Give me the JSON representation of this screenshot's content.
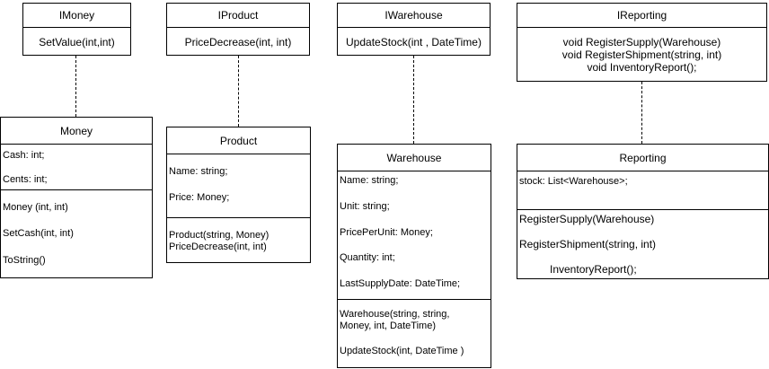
{
  "imoney": {
    "name": "IMoney",
    "methods": [
      "SetValue(int,int)"
    ]
  },
  "iproduct": {
    "name": "IProduct",
    "methods": [
      "PriceDecrease(int, int)"
    ]
  },
  "iwarehouse": {
    "name": "IWarehouse",
    "methods": [
      "UpdateStock(int , DateTime)"
    ]
  },
  "ireporting": {
    "name": "IReporting",
    "methods": [
      "void RegisterSupply(Warehouse)",
      "void RegisterShipment(string, int)",
      "void InventoryReport();"
    ]
  },
  "money": {
    "name": "Money",
    "fields": [
      "Cash: int;",
      "Cents: int;"
    ],
    "methods": [
      "Money (int, int)",
      "SetCash(int, int)",
      "ToString()"
    ]
  },
  "product": {
    "name": "Product",
    "fields": [
      "Name: string;",
      "Price: Money;"
    ],
    "methods": [
      "Product(string, Money)",
      "PriceDecrease(int, int)"
    ]
  },
  "warehouse": {
    "name": "Warehouse",
    "fields": [
      "Name: string;",
      "Unit: string;",
      "PricePerUnit: Money;",
      "Quantity: int;",
      "LastSupplyDate: DateTime;"
    ],
    "methods": [
      "Warehouse(string, string,",
      "Money, int, DateTime)",
      "UpdateStock(int, DateTime )"
    ]
  },
  "reporting": {
    "name": "Reporting",
    "fields": [
      "stock: List<Warehouse>;"
    ],
    "methods": [
      "RegisterSupply(Warehouse)",
      "RegisterShipment(string, int)",
      "InventoryReport();"
    ]
  }
}
